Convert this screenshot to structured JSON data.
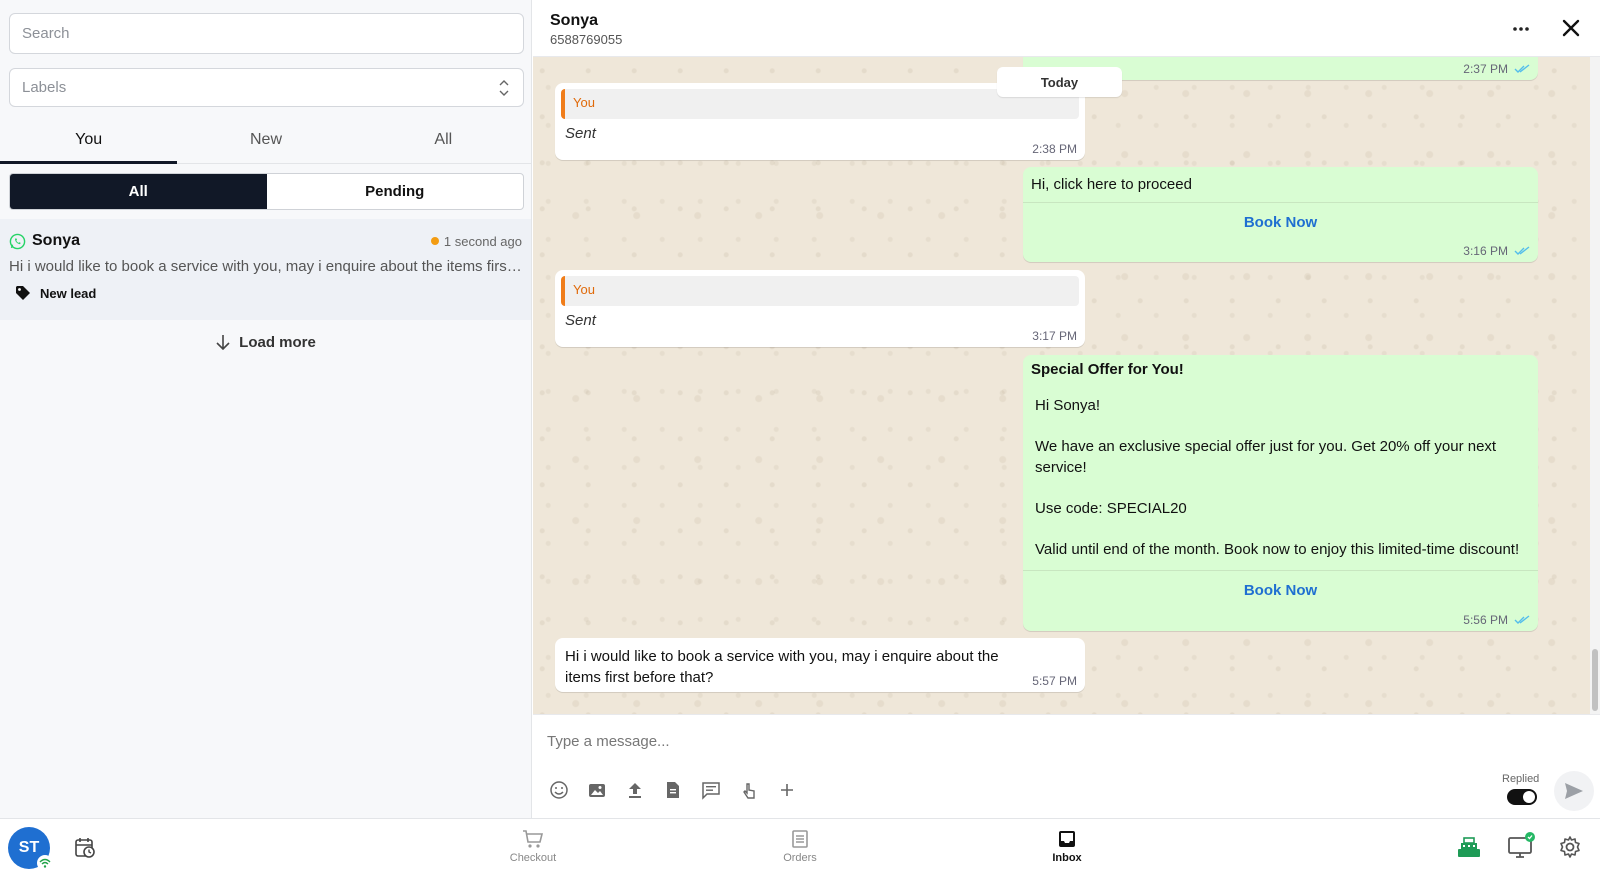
{
  "sidebar": {
    "search_placeholder": "Search",
    "labels_placeholder": "Labels",
    "tabs": [
      {
        "label": "You",
        "active": true
      },
      {
        "label": "New",
        "active": false
      },
      {
        "label": "All",
        "active": false
      }
    ],
    "filter": {
      "all": "All",
      "pending": "Pending",
      "active": "All"
    },
    "conversations": [
      {
        "name": "Sonya",
        "channel_icon": "whatsapp-icon",
        "time": "1 second ago",
        "unread_dot_color": "#f39c12",
        "preview": "Hi i would like to book a service with you, may i enquire about the items first before that?",
        "tag": "New lead"
      }
    ],
    "load_more": "Load more"
  },
  "chat": {
    "contact_name": "Sonya",
    "contact_phone": "6588769055",
    "date_divider": "Today",
    "messages": [
      {
        "direction": "out",
        "time": "2:37 PM",
        "read": true
      },
      {
        "direction": "in",
        "quote_author": "You",
        "text": "Sent",
        "time": "2:38 PM"
      },
      {
        "direction": "out",
        "text": "Hi, click here to proceed",
        "button": "Book Now",
        "time": "3:16 PM",
        "read": true
      },
      {
        "direction": "in",
        "quote_author": "You",
        "text": "Sent",
        "time": "3:17 PM"
      },
      {
        "direction": "out",
        "title": "Special Offer for You!",
        "body": [
          "Hi Sonya!",
          "We have an exclusive special offer just for you. Get 20% off your next service!",
          "Use code: SPECIAL20",
          "Valid until end of the month. Book now to enjoy this limited-time discount!"
        ],
        "button": "Book Now",
        "time": "5:56 PM",
        "read": true
      },
      {
        "direction": "in",
        "text": "Hi i would like to book a service with you, may i enquire about the items first before that?",
        "time": "5:57 PM"
      }
    ]
  },
  "composer": {
    "placeholder": "Type a message...",
    "tools": [
      "emoji-icon",
      "image-icon",
      "upload-icon",
      "document-icon",
      "quick-reply-icon",
      "interactive-icon",
      "add-icon"
    ],
    "replied_label": "Replied",
    "replied_on": true
  },
  "bottom_nav": {
    "avatar_initials": "ST",
    "items": [
      {
        "label": "Checkout",
        "icon": "cart-icon",
        "active": false
      },
      {
        "label": "Orders",
        "icon": "orders-icon",
        "active": false
      },
      {
        "label": "Inbox",
        "icon": "inbox-icon",
        "active": true
      }
    ]
  },
  "colors": {
    "accent_dark": "#111827",
    "outgoing_bubble": "#d9fdd3",
    "link_blue": "#1f6fd1",
    "quote_orange": "#f07d1a",
    "whatsapp_green": "#25d366",
    "avatar_blue": "#1f6fd1"
  }
}
